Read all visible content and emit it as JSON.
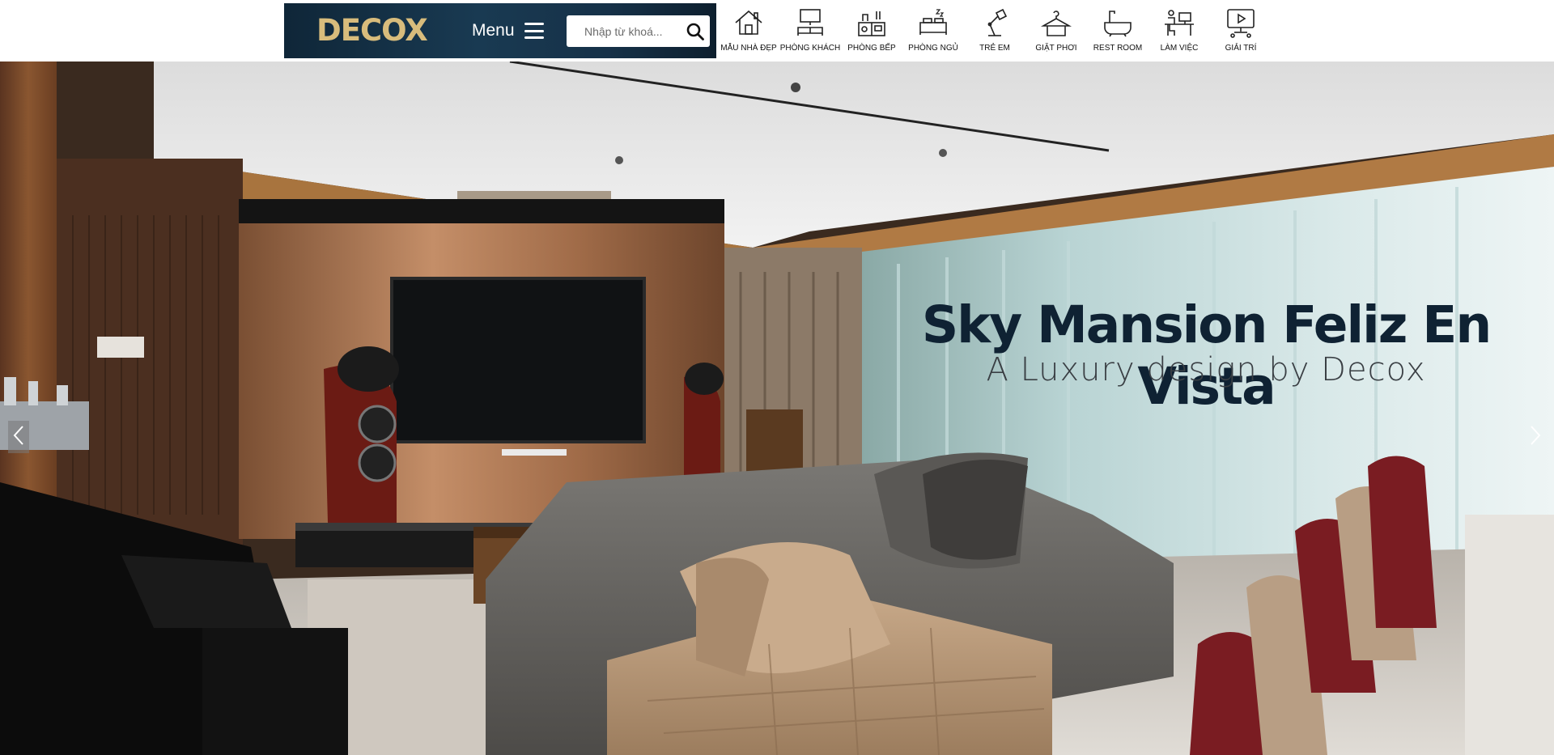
{
  "header": {
    "logo_text": "DECOX",
    "menu_label": "Menu",
    "search_placeholder": "Nhập từ khoá...",
    "categories": [
      {
        "label": "MẪU NHÀ ĐẸP",
        "icon": "house-icon"
      },
      {
        "label": "PHÒNG KHÁCH",
        "icon": "tv-sofa-icon"
      },
      {
        "label": "PHÒNG BẾP",
        "icon": "kitchen-icon"
      },
      {
        "label": "PHÒNG NGỦ",
        "icon": "bed-icon"
      },
      {
        "label": "TRẺ EM",
        "icon": "desk-lamp-icon"
      },
      {
        "label": "GIẶT PHƠI",
        "icon": "hanger-icon"
      },
      {
        "label": "REST ROOM",
        "icon": "bathtub-icon"
      },
      {
        "label": "LÀM VIỆC",
        "icon": "workdesk-icon"
      },
      {
        "label": "GIẢI TRÍ",
        "icon": "play-screen-icon"
      }
    ]
  },
  "hero": {
    "title": "Sky Mansion Feliz En Vista",
    "subtitle": "A Luxury design by Decox",
    "prev_icon": "chevron-left-icon",
    "next_icon": "chevron-right-icon"
  },
  "colors": {
    "brand_dark": "#0f2638",
    "logo_gold": "#d8bc7c",
    "title_navy": "#0f2233"
  }
}
